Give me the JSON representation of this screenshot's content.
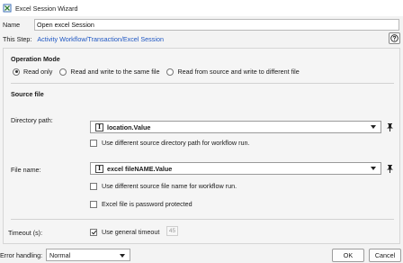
{
  "window": {
    "title": "Excel Session Wizard"
  },
  "name_field": {
    "label": "Name",
    "value": "Open excel Session"
  },
  "step": {
    "label": "This Step:",
    "path": "Activity Workflow/Transaction/Excel Session"
  },
  "operation_mode": {
    "title": "Operation Mode",
    "options": [
      {
        "label": "Read only",
        "selected": true
      },
      {
        "label": "Read and write to the same file",
        "selected": false
      },
      {
        "label": "Read from source and write to different file",
        "selected": false
      }
    ]
  },
  "source_file": {
    "title": "Source file",
    "directory": {
      "label": "Directory path:",
      "value": "location.Value",
      "checkbox_label": "Use different source directory path for workflow run.",
      "checked": false
    },
    "file_name": {
      "label": "File name:",
      "value": "excel fileNAME.Value",
      "checkbox_label": "Use different source file name for workflow run.",
      "checked": false
    },
    "password": {
      "label": "Excel file is password protected",
      "checked": false
    }
  },
  "timeout": {
    "label": "Timeout (s):",
    "checkbox_label": "Use general timeout",
    "checked": true,
    "value": "45"
  },
  "error_handling": {
    "label": "Error handling:",
    "value": "Normal"
  },
  "buttons": {
    "ok": "OK",
    "cancel": "Cancel"
  },
  "icons": {
    "combo_prefix": "I"
  }
}
